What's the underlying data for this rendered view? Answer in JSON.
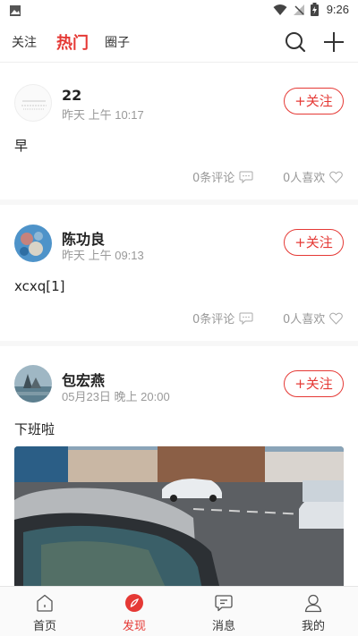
{
  "status_bar": {
    "time": "9:26"
  },
  "top_nav": {
    "tabs": [
      {
        "label": "关注",
        "active": false
      },
      {
        "label": "热门",
        "active": true
      },
      {
        "label": "圈子",
        "active": false
      }
    ],
    "accent_color": "#e53935"
  },
  "posts": [
    {
      "username": "22",
      "time": "昨天 上午 10:17",
      "follow_label": "+关注",
      "content": "早",
      "comments": "0条评论",
      "likes": "0人喜欢"
    },
    {
      "username": "陈功良",
      "time": "昨天 上午 09:13",
      "follow_label": "+关注",
      "content": "xcxq[1]",
      "comments": "0条评论",
      "likes": "0人喜欢"
    },
    {
      "username": "包宏燕",
      "time": "05月23日 晚上 20:00",
      "follow_label": "+关注",
      "content": "下班啦"
    }
  ],
  "bottom_nav": {
    "items": [
      {
        "label": "首页",
        "icon": "home-icon",
        "active": false
      },
      {
        "label": "发现",
        "icon": "discover-icon",
        "active": true
      },
      {
        "label": "消息",
        "icon": "message-icon",
        "active": false
      },
      {
        "label": "我的",
        "icon": "profile-icon",
        "active": false
      }
    ]
  }
}
